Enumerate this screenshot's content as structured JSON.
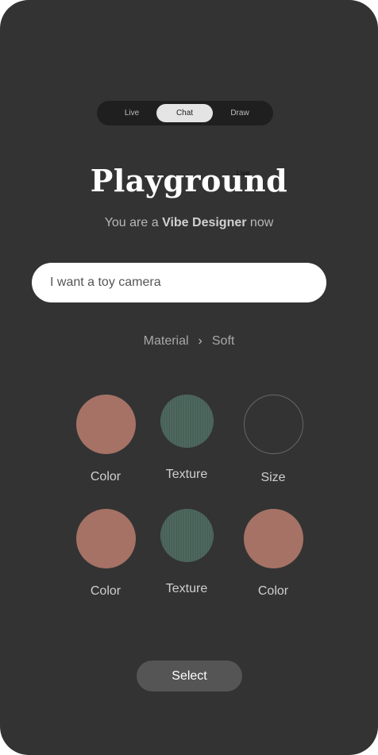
{
  "mode_tabs": [
    {
      "label": "Live",
      "selected": false
    },
    {
      "label": "Chat",
      "selected": true
    },
    {
      "label": "Draw",
      "selected": false
    }
  ],
  "header": {
    "title": "Playground",
    "title_tag": "Live",
    "subtitle_prefix": "You are a ",
    "subtitle_bold": "Vibe Designer",
    "subtitle_suffix": " now"
  },
  "prompt": {
    "value": "I want a toy camera"
  },
  "breadcrumb": {
    "items": [
      "Material",
      "Soft"
    ],
    "separator": "›"
  },
  "options": [
    {
      "label": "Color",
      "kind": "color"
    },
    {
      "label": "Texture",
      "kind": "texture"
    },
    {
      "label": "Size",
      "kind": "empty"
    },
    {
      "label": "Color",
      "kind": "color"
    },
    {
      "label": "Texture",
      "kind": "texture"
    },
    {
      "label": "Color",
      "kind": "color"
    }
  ],
  "colors": {
    "background": "#333333",
    "swatch_color": "#a57265",
    "swatch_texture": "#486259"
  },
  "action": {
    "select_label": "Select"
  }
}
